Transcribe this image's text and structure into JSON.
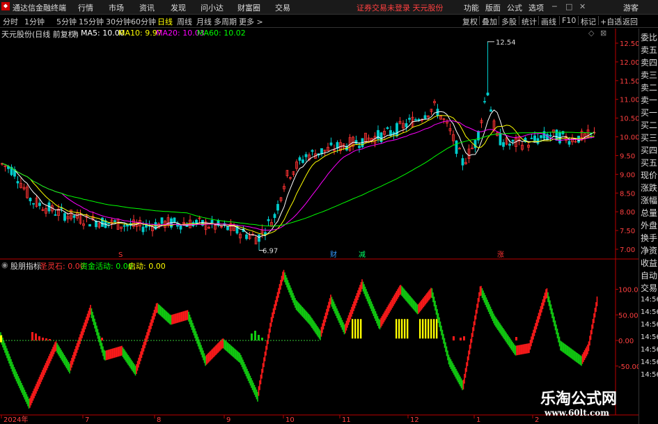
{
  "menubar": {
    "app_title": "通达信金融终端",
    "items": [
      "行情",
      "市场",
      "资讯",
      "发现",
      "问小达",
      "财富圈",
      "交易"
    ],
    "warning": "证券交易未登录  天元股份",
    "right_items": [
      "功能",
      "版面",
      "公式",
      "选项"
    ],
    "guest": "游客"
  },
  "toolbar": {
    "periods": [
      "分时",
      "1分钟",
      "5分钟",
      "15分钟",
      "30分钟",
      "60分钟",
      "日线",
      "周线",
      "月线",
      "多周期",
      "更多 >"
    ],
    "active_period": "日线",
    "buttons": [
      "复权",
      "叠加",
      "多股",
      "统计",
      "画线",
      "F10",
      "标记",
      "+自选",
      "返回"
    ]
  },
  "main_info": {
    "stock": "天元股份(日线 前复权)",
    "ma5": "MA5: 10.00",
    "ma10": "MA10: 9.97",
    "ma20": "MA20: 10.03",
    "ma60": "MA60: 10.02"
  },
  "sub_info": {
    "name": "股朋指标",
    "s1": "圣灵石: 0.00",
    "s2": "资金活动: 0.00",
    "s3": "启动: 0.00"
  },
  "right_panel": {
    "items": [
      "委比",
      "卖五",
      "卖四",
      "卖三",
      "卖二",
      "卖一",
      "买一",
      "买二",
      "买三",
      "买四",
      "买五",
      "现价",
      "涨跌",
      "涨幅",
      "总量",
      "外盘",
      "换手",
      "净资",
      "收益",
      "自动",
      "交易"
    ],
    "times": [
      "14:56",
      "14:56",
      "14:56",
      "14:56",
      "14:56",
      "14:56",
      "14:56"
    ]
  },
  "price_axis": {
    "labels": [
      "12.50",
      "12.00",
      "11.50",
      "11.00",
      "10.50",
      "10.00",
      "9.50",
      "9.00",
      "8.50",
      "8.00",
      "7.50",
      "7.00"
    ],
    "high_label": "12.54",
    "low_label": "6.97"
  },
  "indicator_axis": {
    "labels": [
      "100.00",
      "50.00",
      "0.00",
      "-50.00"
    ]
  },
  "date_axis": {
    "labels": [
      "2024年",
      "7",
      "8",
      "9",
      "10",
      "11",
      "12",
      "1",
      "2"
    ]
  },
  "event_marks": [
    "S",
    "财",
    "减",
    "涨"
  ],
  "colors": {
    "up": "#ff3333",
    "down": "#00cccc",
    "ma5": "#ffffff",
    "ma10": "#ffff00",
    "ma20": "#ff00ff",
    "ma60": "#00ff00",
    "ind_red": "#ff1a1a",
    "ind_green": "#11cc11",
    "ind_yellow": "#ffff00"
  },
  "watermark": {
    "cn": "乐淘公式网",
    "url": "www.60lt.com"
  }
}
